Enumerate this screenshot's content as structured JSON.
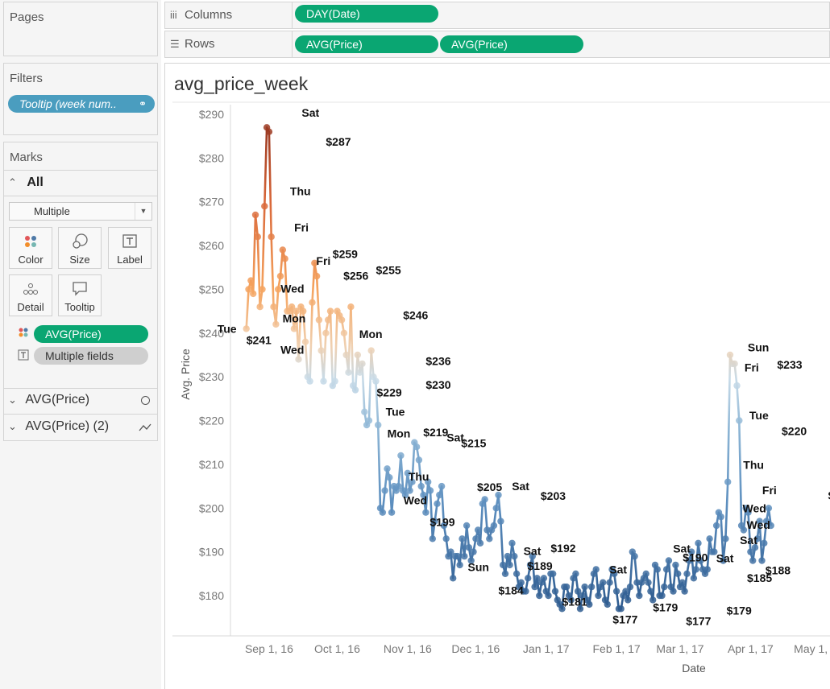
{
  "pages": {
    "title": "Pages"
  },
  "filters": {
    "title": "Filters",
    "pill": "Tooltip (week num.."
  },
  "marks": {
    "title": "Marks",
    "all_label": "All",
    "mark_type": "Multiple",
    "buttons": [
      {
        "label": "Color",
        "icon": "color-dots-icon"
      },
      {
        "label": "Size",
        "icon": "size-circles-icon"
      },
      {
        "label": "Label",
        "icon": "label-t-icon"
      },
      {
        "label": "Detail",
        "icon": "detail-dots-icon"
      },
      {
        "label": "Tooltip",
        "icon": "speech-bubble-icon"
      }
    ],
    "pills": [
      "AVG(Price)",
      "Multiple fields"
    ],
    "cards": [
      {
        "label": "AVG(Price)",
        "icon": "circle-icon"
      },
      {
        "label": "AVG(Price) (2)",
        "icon": "line-icon"
      }
    ]
  },
  "shelves": {
    "columns": {
      "label": "Columns",
      "pills": [
        "DAY(Date)"
      ]
    },
    "rows": {
      "label": "Rows",
      "pills": [
        "AVG(Price)",
        "AVG(Price)"
      ]
    }
  },
  "colors": {
    "accent_green": "#0aa672",
    "filter_blue": "#4a9dbf"
  },
  "chart_data": {
    "type": "line",
    "title": "avg_price_week",
    "xlabel": "Date",
    "ylabel": "Avg. Price",
    "ylim": [
      174,
      292
    ],
    "y_ticks": [
      "$180",
      "$190",
      "$200",
      "$210",
      "$220",
      "$230",
      "$240",
      "$250",
      "$260",
      "$270",
      "$280",
      "$290"
    ],
    "x_ticks": [
      "Sep 1, 16",
      "Oct 1, 16",
      "Nov 1, 16",
      "Dec 1, 16",
      "Jan 1, 17",
      "Feb 1, 17",
      "Mar 1, 17",
      "Apr 1, 17",
      "May 1, 17"
    ],
    "x_range": [
      "2016-08-15",
      "2017-05-06"
    ],
    "start_date": "2016-08-22",
    "values": [
      241,
      250,
      252,
      249,
      267,
      262,
      246,
      250,
      269,
      287,
      286,
      262,
      246,
      242,
      250,
      253,
      259,
      257,
      245,
      245,
      246,
      241,
      245,
      234,
      246,
      245,
      238,
      230,
      229,
      247,
      256,
      253,
      243,
      236,
      229,
      240,
      243,
      245,
      228,
      229,
      245,
      244,
      243,
      240,
      235,
      231,
      246,
      228,
      227,
      235,
      231,
      233,
      222,
      219,
      220,
      236,
      230,
      229,
      219,
      200,
      199,
      204,
      209,
      207,
      199,
      205,
      204,
      205,
      212,
      204,
      203,
      208,
      204,
      206,
      215,
      214,
      211,
      205,
      203,
      199,
      206,
      204,
      193,
      197,
      201,
      203,
      205,
      196,
      193,
      189,
      190,
      184,
      189,
      189,
      187,
      193,
      189,
      196,
      191,
      188,
      190,
      193,
      195,
      192,
      201,
      202,
      195,
      193,
      195,
      196,
      200,
      203,
      197,
      187,
      185,
      189,
      187,
      192,
      189,
      185,
      182,
      183,
      181,
      181,
      184,
      187,
      189,
      182,
      184,
      180,
      183,
      184,
      181,
      180,
      185,
      185,
      181,
      179,
      178,
      177,
      182,
      182,
      180,
      179,
      184,
      185,
      181,
      177,
      180,
      182,
      179,
      178,
      182,
      185,
      186,
      180,
      182,
      183,
      179,
      178,
      183,
      186,
      185,
      181,
      177,
      177,
      180,
      181,
      179,
      182,
      190,
      189,
      183,
      180,
      183,
      184,
      185,
      183,
      181,
      179,
      187,
      186,
      180,
      180,
      182,
      186,
      188,
      182,
      181,
      187,
      185,
      182,
      183,
      181,
      185,
      188,
      190,
      184,
      186,
      192,
      188,
      186,
      185,
      186,
      193,
      190,
      190,
      196,
      199,
      198,
      188,
      193,
      206,
      235,
      233,
      233,
      228,
      220,
      196,
      195,
      200,
      199,
      190,
      188,
      191,
      193,
      197,
      188,
      192,
      197,
      200,
      196
    ]
  },
  "annotations": [
    {
      "t": "Sat",
      "d": "2016-09-26",
      "v": 288,
      "dx": -30,
      "dy": -8
    },
    {
      "t": "$287",
      "d": "2016-09-26",
      "v": 285,
      "dx": 0,
      "dy": 12
    },
    {
      "t": "Thu",
      "d": "2016-09-23",
      "v": 271,
      "dx": -36,
      "dy": -3
    },
    {
      "t": "Fri",
      "d": "2016-09-22",
      "v": 264,
      "dx": -28,
      "dy": 4
    },
    {
      "t": "Wed",
      "d": "2016-09-21",
      "v": 250,
      "dx": -42,
      "dy": 4
    },
    {
      "t": "Mon",
      "d": "2016-09-19",
      "v": 243,
      "dx": -34,
      "dy": 3
    },
    {
      "t": "Tue",
      "d": "2016-08-22",
      "v": 241,
      "dx": -36,
      "dy": 5
    },
    {
      "t": "$241",
      "d": "2016-08-22",
      "v": 241,
      "dx": 0,
      "dy": 19
    },
    {
      "t": "Wed",
      "d": "2016-09-11",
      "v": 239,
      "dx": -14,
      "dy": 20
    },
    {
      "t": "$259",
      "d": "2016-09-29",
      "v": 259,
      "dx": 0,
      "dy": 10
    },
    {
      "t": "Fri",
      "d": "2016-09-26",
      "v": 256,
      "dx": -12,
      "dy": 2
    },
    {
      "t": "$256",
      "d": "2016-10-03",
      "v": 255,
      "dx": 2,
      "dy": 15
    },
    {
      "t": "$255",
      "d": "2016-10-17",
      "v": 255,
      "dx": 3,
      "dy": 8
    },
    {
      "t": "Mon",
      "d": "2016-10-10",
      "v": 240,
      "dx": 2,
      "dy": 6
    },
    {
      "t": "$246",
      "d": "2016-10-30",
      "v": 245,
      "dx": 0,
      "dy": 10
    },
    {
      "t": "$229",
      "d": "2016-10-17",
      "v": 229,
      "dx": 4,
      "dy": 19
    },
    {
      "t": "$236",
      "d": "2016-11-09",
      "v": 236,
      "dx": 0,
      "dy": 18
    },
    {
      "t": "$230",
      "d": "2016-11-09",
      "v": 230,
      "dx": 0,
      "dy": 15
    },
    {
      "t": "Tue",
      "d": "2016-11-02",
      "v": 222,
      "dx": -30,
      "dy": 5
    },
    {
      "t": "Mon",
      "d": "2016-11-02",
      "v": 218,
      "dx": -28,
      "dy": 10
    },
    {
      "t": "$219",
      "d": "2016-11-10",
      "v": 219,
      "dx": -6,
      "dy": 14
    },
    {
      "t": "Sat",
      "d": "2016-11-21",
      "v": 216,
      "dx": -8,
      "dy": 4
    },
    {
      "t": "$215",
      "d": "2016-11-26",
      "v": 215,
      "dx": -4,
      "dy": 6
    },
    {
      "t": "Thu",
      "d": "2016-11-12",
      "v": 207,
      "dx": -30,
      "dy": 4
    },
    {
      "t": "Wed",
      "d": "2016-11-12",
      "v": 199,
      "dx": -36,
      "dy": -10
    },
    {
      "t": "$205",
      "d": "2016-12-03",
      "v": 205,
      "dx": -4,
      "dy": 6
    },
    {
      "t": "$199",
      "d": "2016-11-20",
      "v": 199,
      "dx": -26,
      "dy": 17
    },
    {
      "t": "Sat",
      "d": "2016-12-24",
      "v": 203,
      "dx": -20,
      "dy": -6
    },
    {
      "t": "$203",
      "d": "2016-12-31",
      "v": 203,
      "dx": -4,
      "dy": 6
    },
    {
      "t": "Sun",
      "d": "2016-12-11",
      "v": 186,
      "dx": -38,
      "dy": 2
    },
    {
      "t": "$184",
      "d": "2016-12-11",
      "v": 184,
      "dx": 0,
      "dy": 20
    },
    {
      "t": "Sat",
      "d": "2016-12-27",
      "v": 190,
      "dx": -14,
      "dy": 4
    },
    {
      "t": "$192",
      "d": "2017-01-03",
      "v": 191,
      "dx": 0,
      "dy": 6
    },
    {
      "t": "$189",
      "d": "2016-12-28",
      "v": 189,
      "dx": -12,
      "dy": 17
    },
    {
      "t": "$181",
      "d": "2017-01-08",
      "v": 181,
      "dx": 0,
      "dy": 18
    },
    {
      "t": "Sat",
      "d": "2017-01-31",
      "v": 184,
      "dx": -6,
      "dy": -6
    },
    {
      "t": "$177",
      "d": "2017-01-31",
      "v": 177,
      "dx": -2,
      "dy": 18
    },
    {
      "t": "$179",
      "d": "2017-02-17",
      "v": 179,
      "dx": 0,
      "dy": 14
    },
    {
      "t": "Sat",
      "d": "2017-02-28",
      "v": 188,
      "dx": -6,
      "dy": -10
    },
    {
      "t": "$190",
      "d": "2017-03-05",
      "v": 190,
      "dx": -8,
      "dy": 12
    },
    {
      "t": "$177",
      "d": "2017-03-05",
      "v": 177,
      "dx": -4,
      "dy": 20
    },
    {
      "t": "Sat",
      "d": "2017-03-19",
      "v": 188,
      "dx": -6,
      "dy": 2
    },
    {
      "t": "$179",
      "d": "2017-03-25",
      "v": 179,
      "dx": -10,
      "dy": 18
    },
    {
      "t": "Sat",
      "d": "2017-03-28",
      "v": 191,
      "dx": -2,
      "dy": -4
    },
    {
      "t": "Wed",
      "d": "2017-03-31",
      "v": 196,
      "dx": -2,
      "dy": 4
    },
    {
      "t": "$185",
      "d": "2017-04-03",
      "v": 185,
      "dx": -10,
      "dy": 10
    },
    {
      "t": "$188",
      "d": "2017-04-09",
      "v": 188,
      "dx": -4,
      "dy": 17
    },
    {
      "t": "Wed",
      "d": "2017-04-06",
      "v": 200,
      "dx": -24,
      "dy": 5
    },
    {
      "t": "Fri",
      "d": "2017-04-09",
      "v": 203,
      "dx": -8,
      "dy": -1
    },
    {
      "t": "Thu",
      "d": "2017-04-07",
      "v": 209,
      "dx": -26,
      "dy": 0
    },
    {
      "t": "Tue",
      "d": "2017-04-09",
      "v": 221,
      "dx": -24,
      "dy": 4
    },
    {
      "t": "$220",
      "d": "2017-04-14",
      "v": 220,
      "dx": 2,
      "dy": 18
    },
    {
      "t": "Sun",
      "d": "2017-04-09",
      "v": 236,
      "dx": -26,
      "dy": 1
    },
    {
      "t": "Fri",
      "d": "2017-04-09",
      "v": 232,
      "dx": -30,
      "dy": 4
    },
    {
      "t": "$233",
      "d": "2017-04-12",
      "v": 233,
      "dx": 2,
      "dy": 6
    },
    {
      "t": "S",
      "d": "2017-05-05",
      "v": 202,
      "dx": 0,
      "dy": 0
    }
  ]
}
